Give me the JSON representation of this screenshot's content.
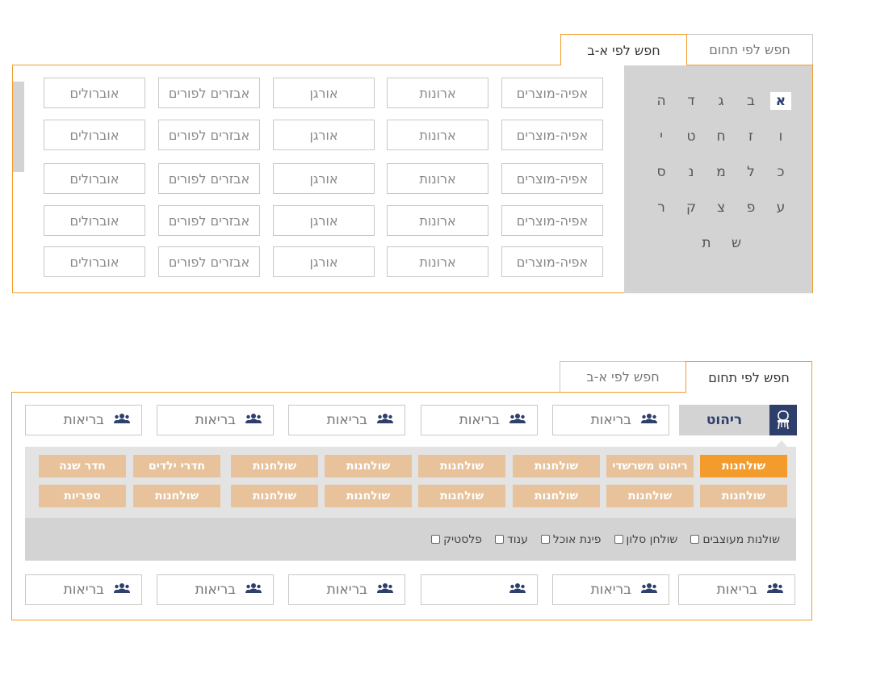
{
  "top": {
    "tabs": [
      {
        "label": "חפש לפי תחום",
        "active": false
      },
      {
        "label": "חפש לפי א-ב",
        "active": true
      }
    ],
    "letters": [
      [
        "א",
        "ב",
        "ג",
        "ד",
        "ה"
      ],
      [
        "ו",
        "ז",
        "ח",
        "ט",
        "י"
      ],
      [
        "כ",
        "ל",
        "מ",
        "נ",
        "ס"
      ],
      [
        "ע",
        "פ",
        "צ",
        "ק",
        "ר"
      ],
      [
        "ש",
        "ת"
      ]
    ],
    "selected_letter": "א",
    "grid_rows": [
      [
        "אפיה-מוצרים",
        "ארונות",
        "אורגן",
        "אבזרים לפורים",
        "אוברולים"
      ],
      [
        "אפיה-מוצרים",
        "ארונות",
        "אורגן",
        "אבזרים לפורים",
        "אוברולים"
      ],
      [
        "אפיה-מוצרים",
        "ארונות",
        "אורגן",
        "אבזרים לפורים",
        "אוברולים"
      ],
      [
        "אפיה-מוצרים",
        "ארונות",
        "אורגן",
        "אבזרים לפורים",
        "אוברולים"
      ],
      [
        "אפיה-מוצרים",
        "ארונות",
        "אורגן",
        "אבזרים לפורים",
        "אוברולים"
      ]
    ]
  },
  "bottom": {
    "tabs": [
      {
        "label": "חפש לפי תחום",
        "active": true
      },
      {
        "label": "חפש לפי א-ב",
        "active": false
      }
    ],
    "category": {
      "label": "ריהוט",
      "icon": "chair-icon"
    },
    "top_fields": [
      "בריאות",
      "בריאות",
      "בריאות",
      "בריאות",
      "בריאות"
    ],
    "chips_row1": [
      "שולחנות",
      "ריהוט משרשדי",
      "שולחנות",
      "שולחנות",
      "שולחנות",
      "שולחנות",
      "חדרי ילדים",
      "חדר שנה"
    ],
    "chips_row2": [
      "שולחנות",
      "שולחנות",
      "שולחנות",
      "שולחנות",
      "שולחנות",
      "שולחנות",
      "שולחנות",
      "ספריות"
    ],
    "active_chip": "שולחנות",
    "filters": [
      "שולנות מעוצבים",
      "שולחן סלון",
      "פינת אוכל",
      "ענוד",
      "פלסטיק"
    ],
    "bottom_fields": [
      "בריאות",
      "בריאות",
      "",
      "בריאות",
      "בריאות",
      "בריאות"
    ],
    "field_icon": "users-icon"
  },
  "colors": {
    "accent": "#f39c2b",
    "navy": "#2d3f6a",
    "chip": "#e8c29a",
    "panel_gray": "#d3d3d3"
  }
}
